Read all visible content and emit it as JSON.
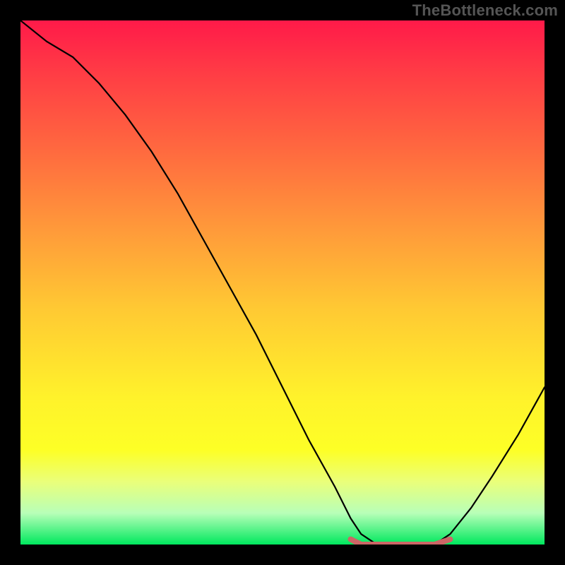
{
  "attribution": "TheBottleneck.com",
  "chart_data": {
    "type": "line",
    "title": "",
    "xlabel": "",
    "ylabel": "",
    "xlim": [
      0,
      100
    ],
    "ylim": [
      0,
      100
    ],
    "series": [
      {
        "name": "bottleneck-curve",
        "x": [
          0,
          5,
          10,
          15,
          20,
          25,
          30,
          35,
          40,
          45,
          50,
          55,
          60,
          63,
          65,
          68,
          72,
          76,
          79,
          82,
          86,
          90,
          95,
          100
        ],
        "values": [
          100,
          96,
          93,
          88,
          82,
          75,
          67,
          58,
          49,
          40,
          30,
          20,
          11,
          5,
          2,
          0,
          0,
          0,
          0,
          2,
          7,
          13,
          21,
          30
        ]
      },
      {
        "name": "optimal-range-marker",
        "x": [
          63,
          65,
          68,
          72,
          76,
          79,
          82
        ],
        "values": [
          1,
          0,
          0,
          0,
          0,
          0,
          1
        ]
      }
    ],
    "colors": {
      "curve_stroke": "#000000",
      "marker_stroke": "#cc6666",
      "gradient_top": "#ff1a49",
      "gradient_mid": "#ffe02b",
      "gradient_bottom": "#00e85e"
    }
  }
}
